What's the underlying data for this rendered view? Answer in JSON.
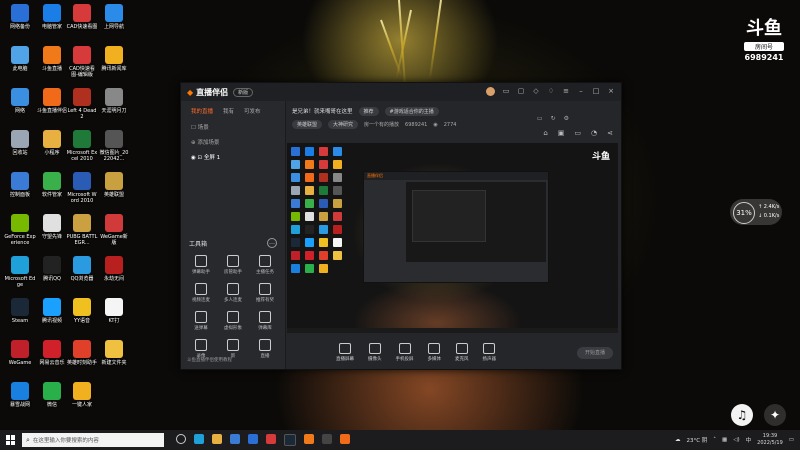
{
  "desktop": {
    "icons": [
      {
        "label": "网络备份",
        "color": "#2a6fd6"
      },
      {
        "label": "电脑管家",
        "color": "#1a7ee6"
      },
      {
        "label": "CAD快速看图",
        "color": "#d63a3a"
      },
      {
        "label": "上网导航",
        "color": "#2a8be8"
      },
      {
        "label": "此电脑",
        "color": "#4fa3e6"
      },
      {
        "label": "斗鱼直播",
        "color": "#f07a1a"
      },
      {
        "label": "CAD快速看图-编辑版",
        "color": "#d63a3a"
      },
      {
        "label": "腾讯新闻库",
        "color": "#f0b020"
      },
      {
        "label": "网络",
        "color": "#3a8fe0"
      },
      {
        "label": "斗鱼直播伴侣",
        "color": "#f06a1a"
      },
      {
        "label": "Left 4 Dead 2",
        "color": "#b03020"
      },
      {
        "label": "天涯明月刀",
        "color": "#888888"
      },
      {
        "label": "回收站",
        "color": "#9aa6b3"
      },
      {
        "label": "小程序",
        "color": "#e8b040"
      },
      {
        "label": "Microsoft Excel 2010",
        "color": "#1f7a3a"
      },
      {
        "label": "微信图片_2022042...",
        "color": "#555555"
      },
      {
        "label": "控制面板",
        "color": "#3a7bd5"
      },
      {
        "label": "软件管家",
        "color": "#3ab04a"
      },
      {
        "label": "Microsoft Word 2010",
        "color": "#2a5bb5"
      },
      {
        "label": "英雄联盟",
        "color": "#c8a040"
      },
      {
        "label": "GeForce Experience",
        "color": "#76b900"
      },
      {
        "label": "守望先锋",
        "color": "#e0e0e0"
      },
      {
        "label": "PUBG BATTLEGR...",
        "color": "#caa040"
      },
      {
        "label": "WeGame新版",
        "color": "#d03a3a"
      },
      {
        "label": "Microsoft Edge",
        "color": "#1fa0d8"
      },
      {
        "label": "腾讯QQ",
        "color": "#222222"
      },
      {
        "label": "QQ浏览器",
        "color": "#2a9be0"
      },
      {
        "label": "永劫无间",
        "color": "#b82020"
      },
      {
        "label": "Steam",
        "color": "#1b2838"
      },
      {
        "label": "腾讯视频",
        "color": "#1aa0ff"
      },
      {
        "label": "YY语音",
        "color": "#f0c020"
      },
      {
        "label": "KT打",
        "color": "#f5f5f5"
      },
      {
        "label": "WeGame",
        "color": "#c0202a"
      },
      {
        "label": "网易云音乐",
        "color": "#d0202a"
      },
      {
        "label": "英雄时刻助手",
        "color": "#e0402a"
      },
      {
        "label": "新建文件夹",
        "color": "#f0c040"
      },
      {
        "label": "暴雪战网",
        "color": "#1a80e0"
      },
      {
        "label": "微信",
        "color": "#2ab04a"
      },
      {
        "label": "一键人家",
        "color": "#f0b020"
      }
    ]
  },
  "brand": {
    "logo": "斗鱼",
    "room_label": "房间号",
    "room_number": "6989241"
  },
  "weather_widget": {
    "percent": "31%",
    "up": "↑ 2.4K/s",
    "down": "↓ 0.1K/s"
  },
  "app": {
    "name": "直播伴侣",
    "version_label": "新版",
    "tabs": [
      "我的直播",
      "我有",
      "可发布"
    ],
    "scenes": [
      {
        "label": "场景"
      },
      {
        "label": "添加场景"
      },
      {
        "label": "全屏 1"
      }
    ],
    "tools_header": "工具箱",
    "tools": [
      {
        "label": "弹幕助手"
      },
      {
        "label": "房管助手"
      },
      {
        "label": "主播任务"
      },
      {
        "label": "视频连麦"
      },
      {
        "label": "多人连麦"
      },
      {
        "label": "推荐有奖"
      },
      {
        "label": "送弹幕"
      },
      {
        "label": "虚拟形象"
      },
      {
        "label": "弹幕库"
      },
      {
        "label": "录像"
      },
      {
        "label": "新"
      },
      {
        "label": "直播"
      }
    ],
    "sidebar_footer": "斗鱼直播伴侣使用教程",
    "stream_title": "是兄弟！就来嘴哥在这里",
    "tags": [
      "推荐",
      "#游戏适合你的主播"
    ],
    "category_tags": [
      "英雄联盟",
      "大神研究"
    ],
    "line2": "房一个有的播放",
    "room_id": "6989241",
    "viewers": "2774",
    "bottom_buttons": [
      {
        "label": "直播屏幕"
      },
      {
        "label": "摄像头"
      },
      {
        "label": "手机投屏"
      },
      {
        "label": "多媒体"
      },
      {
        "label": "麦克风"
      },
      {
        "label": "扬声器"
      }
    ],
    "go_live": "开始直播"
  },
  "taskbar": {
    "search_placeholder": "在这里输入你要搜索的内容",
    "weather": "23°C 阴",
    "lang": "中",
    "time": "19:39",
    "date": "2022/5/19"
  }
}
